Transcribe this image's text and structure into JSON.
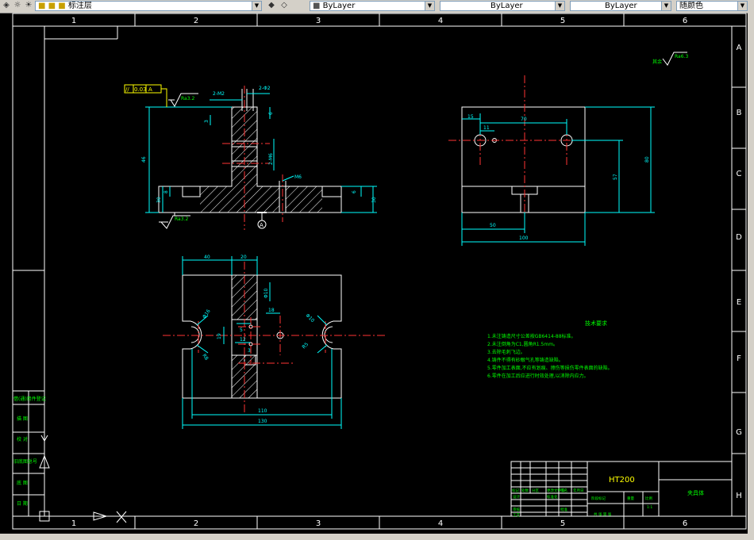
{
  "toolbar": {
    "layer_name": "标注层",
    "color_control": "ByLayer",
    "linetype_control": "ByLayer",
    "lineweight_control": "ByLayer",
    "plot_style": "随颜色"
  },
  "frame": {
    "zone_numbers": [
      "1",
      "2",
      "3",
      "4",
      "5",
      "6"
    ],
    "zone_letters": [
      "A",
      "B",
      "C",
      "D",
      "E",
      "F",
      "G",
      "H"
    ]
  },
  "side_table": [
    "借(通)用件登记",
    "描 图",
    "校 对",
    "旧底图总号",
    "底 图",
    "日 期"
  ],
  "title_block": {
    "material": "HT200",
    "part_name": "夹具体",
    "row_labels": [
      "标记",
      "处数",
      "分区",
      "更改文件号",
      "签名",
      "年月日"
    ],
    "left_labels": [
      "设计",
      "审核",
      "工艺",
      "标准化",
      "批准"
    ],
    "stage_label": "阶段标记",
    "weight_label": "重量",
    "scale_label": "比例",
    "scale_value": "1:1",
    "sheet_label": "共 张 第 张"
  },
  "technical_requirements": {
    "heading": "技术要求",
    "items": [
      "1.未注铸造尺寸公差按GB6414-88标准。",
      "2.未注倒角为C1,圆角R1.5mm。",
      "3.去除毛刺飞边。",
      "4.铸件不得有砂眼气孔等铸造缺陷。",
      "5.零件加工表面,不应有划痕、擦伤等损伤零件表面的缺陷。",
      "6.零件在加工后应进行时效处理,以消除内应力。"
    ]
  },
  "roughness": {
    "general_mark": "其余",
    "general_value": "Ra6.3",
    "top_value": "Ra3.2",
    "bottom_value": "Ra3.2"
  },
  "tolerance_frame": {
    "symbol": "//",
    "value": "0.03",
    "datum": "A"
  },
  "datum_label": "A",
  "dims": {
    "top_thread_left": "2-M2",
    "top_thread_right": "2-Φ2",
    "dim_3": "3",
    "dim_6_top": "6",
    "dim_2m6": "2-M6",
    "dim_m6": "M6",
    "dim_46": "46",
    "dim_8": "8",
    "dim_30_left": "30",
    "dim_6_right": "6",
    "dim_30_right": "30",
    "side_15": "15",
    "side_70": "70",
    "side_11": "11",
    "side_50": "50",
    "side_100": "100",
    "side_57": "57",
    "side_80": "80",
    "plan_40": "40",
    "plan_20": "20",
    "plan_r10": "Φ10",
    "plan_18": "18",
    "plan_5": "5",
    "plan_12": "12",
    "plan_19": "19",
    "plan_3": "3",
    "plan_r5": "R5",
    "plan_d16": "Φ16",
    "plan_r8": "R8",
    "plan_d10": "Φ10",
    "plan_r5b": "R5",
    "plan_110": "110",
    "plan_130": "130"
  }
}
